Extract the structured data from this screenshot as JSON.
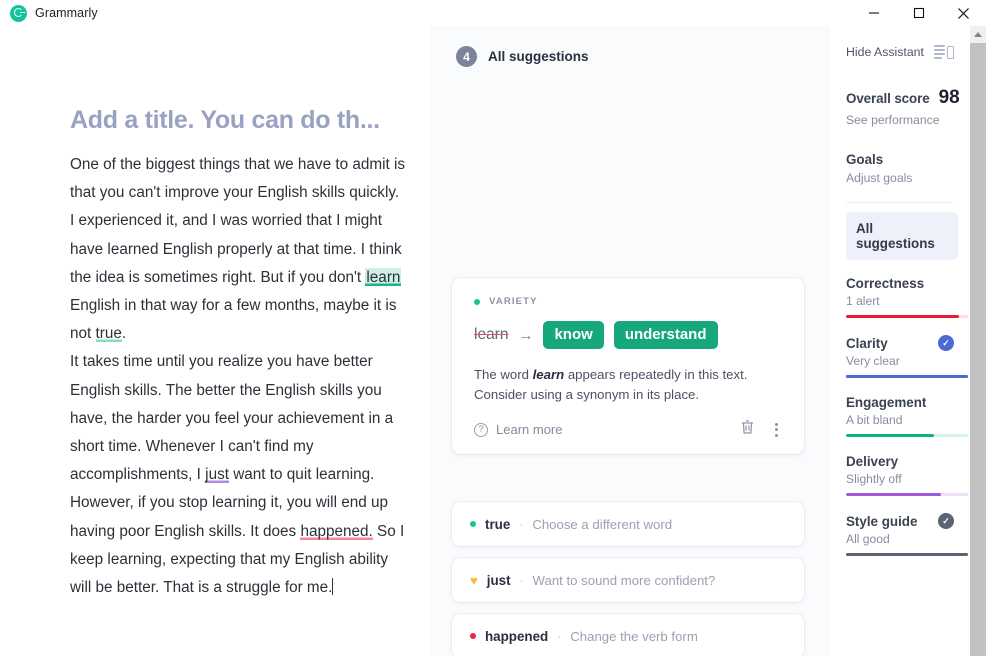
{
  "window": {
    "app_name": "Grammarly",
    "logo_icon": "grammarly-logo-icon",
    "minimize_label": "Minimize",
    "maximize_label": "Maximize",
    "close_label": "Close"
  },
  "menu_button": {
    "icon": "hamburger-menu-icon"
  },
  "editor": {
    "title_placeholder": "Add a title. You can do th...",
    "paragraphs": [
      {
        "id": "p1",
        "runs": [
          {
            "text": "One of the biggest things that we have to admit is that you can't improve your English skills quickly.",
            "mark": "none"
          }
        ]
      },
      {
        "id": "p2",
        "runs": [
          {
            "text": "I experienced it, and I was worried that I might have learned English properly at that time. I think the idea is sometimes right. But if you don't ",
            "mark": "none"
          },
          {
            "text": "learn",
            "mark": "highlight-green"
          },
          {
            "text": " English in that way for a few months, maybe it is not ",
            "mark": "none"
          },
          {
            "text": "true",
            "mark": "underline-green"
          },
          {
            "text": ".",
            "mark": "none"
          }
        ]
      },
      {
        "id": "p3",
        "runs": [
          {
            "text": "It takes time until you realize you have better English skills. The better the English skills you have, the harder you feel your achievement in a short time. Whenever I can't find my accomplishments, I ",
            "mark": "none"
          },
          {
            "text": "just",
            "mark": "underline-purple"
          },
          {
            "text": " want to quit learning.",
            "mark": "none"
          }
        ]
      },
      {
        "id": "p4",
        "runs": [
          {
            "text": "However, if you stop learning it, you will end up having poor English skills. It does ",
            "mark": "none"
          },
          {
            "text": "happened.",
            "mark": "underline-red"
          },
          {
            "text": " So I keep learning, expecting that my English ability will be better. That is a struggle for me.",
            "mark": "none"
          }
        ]
      }
    ]
  },
  "suggestions_panel": {
    "header_label": "All suggestions",
    "header_count": "4",
    "main_card": {
      "category": "VARIETY",
      "category_color": "#15c39a",
      "original_word": "learn",
      "arrow": "→",
      "replacements": [
        "know",
        "understand"
      ],
      "explanation_before": "The word ",
      "explanation_bold": "learn",
      "explanation_after": " appears repeatedly in this text. Consider using a synonym in its place.",
      "learn_more_label": "Learn more",
      "help_icon": "question-mark-icon",
      "delete_icon": "trash-icon",
      "more_icon": "kebab-menu-icon"
    },
    "mini_cards": [
      {
        "word": "true",
        "separator": "·",
        "description": "Choose a different word",
        "marker": "dot",
        "color": "#15c39a"
      },
      {
        "word": "just",
        "separator": "·",
        "description": "Want to sound more confident?",
        "marker": "heart",
        "color": "#f5b93f",
        "icon_glyph": "♥"
      },
      {
        "word": "happened",
        "separator": "·",
        "description": "Change the verb form",
        "marker": "dot",
        "color": "#e8264a"
      }
    ]
  },
  "assistant": {
    "hide_label": "Hide Assistant",
    "panel_icon": "side-panel-icon",
    "overall_score_label": "Overall score",
    "overall_score_value": "98",
    "see_performance_label": "See performance",
    "goals_label": "Goals",
    "adjust_goals_label": "Adjust goals",
    "all_suggestions_label": "All suggestions",
    "metrics": [
      {
        "name": "Correctness",
        "status": "1 alert",
        "color": "#ed1b38",
        "track": "#fbdce1",
        "fill_pct": 93,
        "check": false
      },
      {
        "name": "Clarity",
        "status": "Very clear",
        "color": "#4a6bd6",
        "track": "#4a6bd6",
        "fill_pct": 100,
        "check": true,
        "check_color": "#4a6bd6",
        "check_icon": "check-circle-icon"
      },
      {
        "name": "Engagement",
        "status": "A bit bland",
        "color": "#12b183",
        "track": "#d5f3e9",
        "fill_pct": 72,
        "check": false
      },
      {
        "name": "Delivery",
        "status": "Slightly off",
        "color": "#a259d9",
        "track": "#f0ddfa",
        "fill_pct": 78,
        "check": false
      },
      {
        "name": "Style guide",
        "status": "All good",
        "color": "#5c6374",
        "track": "#5c6374",
        "fill_pct": 100,
        "check": true,
        "check_color": "#5c6374",
        "check_icon": "check-circle-icon"
      }
    ]
  },
  "scrollbar": {
    "arrow_icon": "scroll-up-arrow-icon"
  }
}
